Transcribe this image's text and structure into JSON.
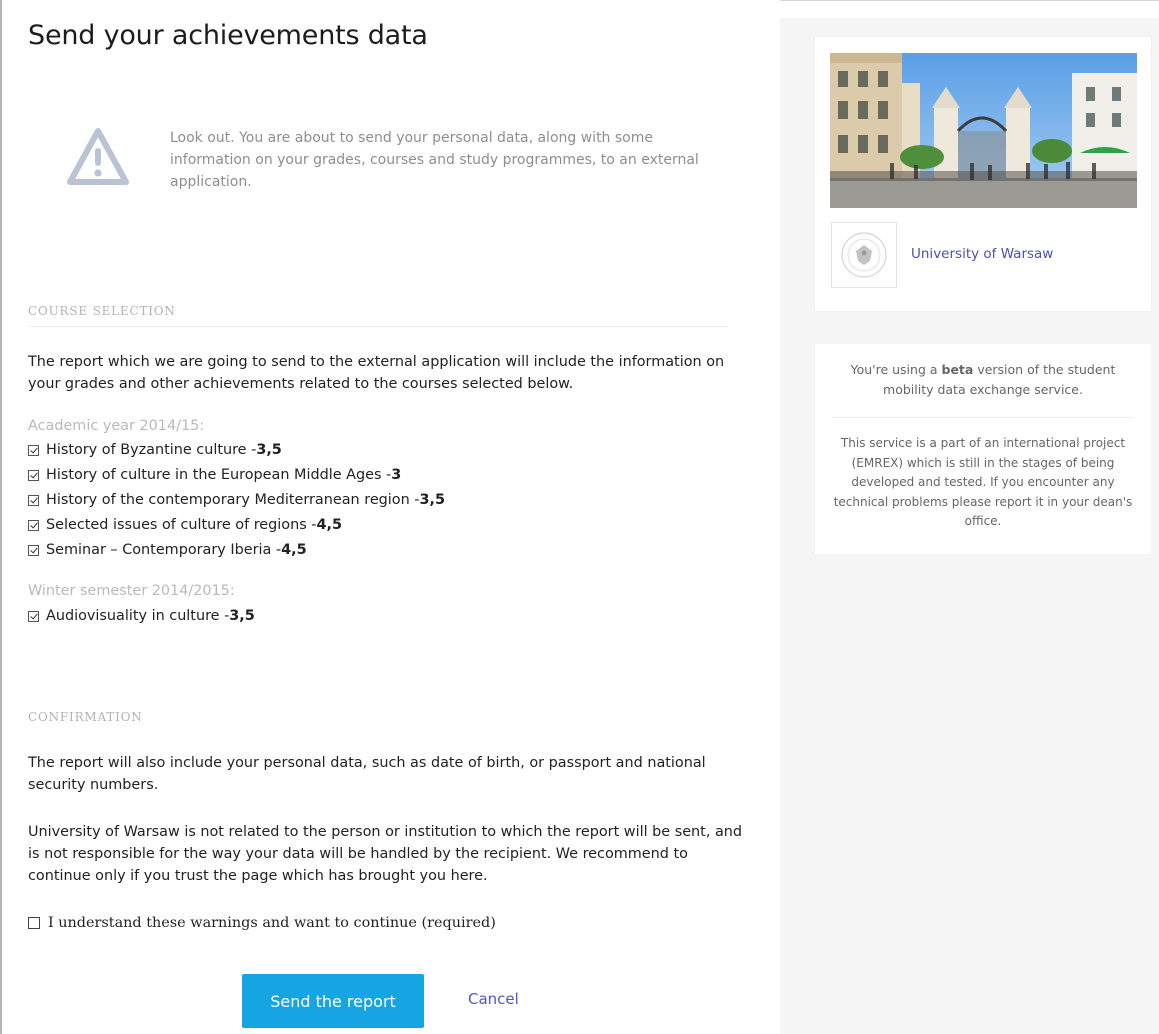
{
  "page": {
    "title": "Send your achievements data",
    "warning": "Look out. You are about to send your personal data, along with some information on your grades, courses and study programmes, to an external application."
  },
  "course_selection": {
    "heading": "COURSE SELECTION",
    "intro": "The report which we are going to send to the external application will include the information on your grades and other achievements related to the courses selected below.",
    "groups": [
      {
        "label": "Academic year 2014/15:",
        "courses": [
          {
            "name": "History of Byzantine culture - ",
            "grade": "3,5",
            "checked": true
          },
          {
            "name": "History of culture in the European Middle Ages - ",
            "grade": "3",
            "checked": true
          },
          {
            "name": "History of the contemporary Mediterranean region - ",
            "grade": "3,5",
            "checked": true
          },
          {
            "name": "Selected issues of culture of regions - ",
            "grade": "4,5",
            "checked": true
          },
          {
            "name": "Seminar – Contemporary Iberia - ",
            "grade": "4,5",
            "checked": true
          }
        ]
      },
      {
        "label": "Winter semester 2014/2015:",
        "courses": [
          {
            "name": "Audiovisuality in culture - ",
            "grade": "3,5",
            "checked": true
          }
        ]
      }
    ]
  },
  "confirmation": {
    "heading": "CONFIRMATION",
    "para1": "The report will also include your personal data, such as date of birth, or passport and national security numbers.",
    "para2": "University of Warsaw is not related to the person or institution to which the report will be sent, and is not responsible for the way your data will be handled by the recipient. We recommend to continue only if you trust the page which has brought you here.",
    "checkbox_label": "I understand these warnings and want to continue (required)",
    "checkbox_checked": false
  },
  "actions": {
    "send_label": "Send the report",
    "cancel_label": "Cancel"
  },
  "sidebar": {
    "university_name": "University of Warsaw",
    "beta_pre": "You're using a ",
    "beta_bold": "beta",
    "beta_post": " version of the student mobility data exchange service.",
    "info": "This service is a part of an international project (EMREX) which is still in the stages of being developed and tested. If you encounter any technical problems please report it in your dean's office."
  },
  "colors": {
    "accent": "#14a5e2",
    "link": "#4f57c7",
    "muted": "#b9b9b9",
    "warning_icon": "#b9c3d3"
  }
}
